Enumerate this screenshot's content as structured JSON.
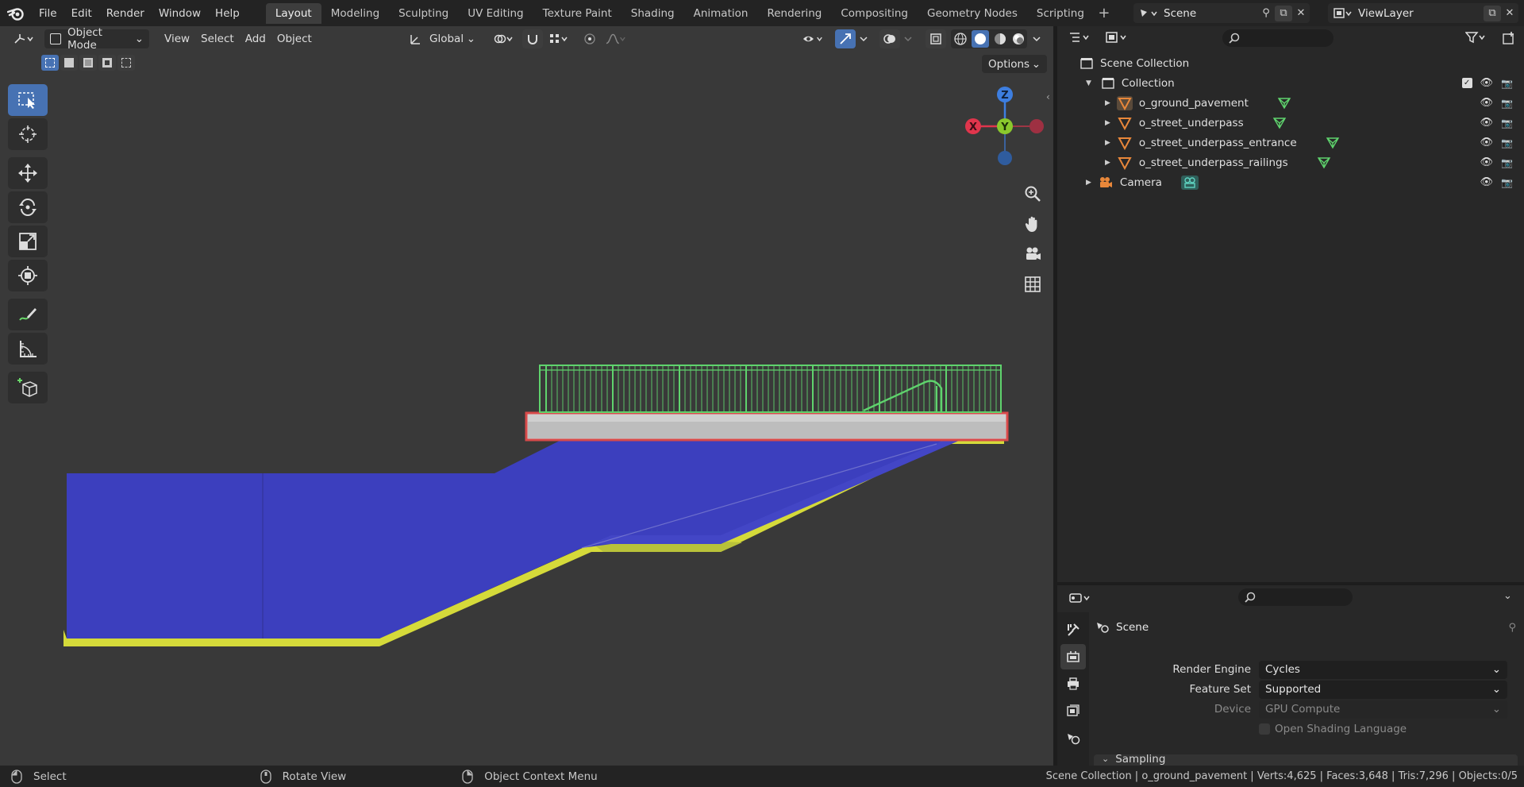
{
  "menu": [
    "File",
    "Edit",
    "Render",
    "Window",
    "Help"
  ],
  "workspaces": [
    "Layout",
    "Modeling",
    "Sculpting",
    "UV Editing",
    "Texture Paint",
    "Shading",
    "Animation",
    "Rendering",
    "Compositing",
    "Geometry Nodes",
    "Scripting"
  ],
  "active_workspace": "Layout",
  "scene_name": "Scene",
  "view_layer": "ViewLayer",
  "viewport": {
    "mode": "Object Mode",
    "menus": [
      "View",
      "Select",
      "Add",
      "Object"
    ],
    "orientation": "Global",
    "options": "Options",
    "gizmo_axes": {
      "z": "Z",
      "y": "Y",
      "x": "X"
    }
  },
  "outliner": {
    "root": "Scene Collection",
    "collection": "Collection",
    "objects": [
      "o_ground_pavement",
      "o_street_underpass",
      "o_street_underpass_entrance",
      "o_street_underpass_railings"
    ],
    "camera": "Camera"
  },
  "properties": {
    "title": "Scene",
    "render_engine_label": "Render Engine",
    "render_engine": "Cycles",
    "feature_set_label": "Feature Set",
    "feature_set": "Supported",
    "device_label": "Device",
    "device": "GPU Compute",
    "osl_label": "Open Shading Language",
    "sampling": "Sampling"
  },
  "status": {
    "select": "Select",
    "rotate": "Rotate View",
    "context": "Object Context Menu",
    "info": "Scene Collection | o_ground_pavement | Verts:4,625 | Faces:3,648 | Tris:7,296 | Objects:0/5"
  },
  "colors": {
    "selection_blue": "#4772b3",
    "object_orange": "#e8873a",
    "mesh_green": "#5fd36d",
    "axis_x": "#e0354c",
    "axis_y": "#8ac82c",
    "axis_z": "#3d7ee0"
  }
}
